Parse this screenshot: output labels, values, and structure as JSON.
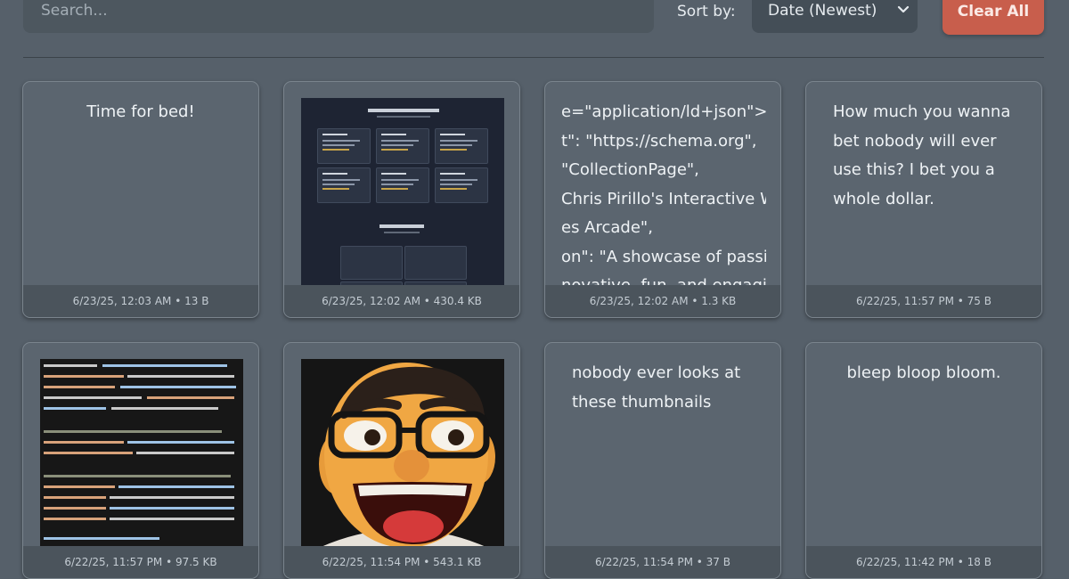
{
  "toolbar": {
    "search_placeholder": "Search...",
    "sort_label": "Sort by:",
    "sort_value": "Date (Newest)",
    "clear_label": "Clear All"
  },
  "colors": {
    "background": "#56606a",
    "card": "#5b656f",
    "accent_button": "#c85e4c"
  },
  "cards": [
    {
      "type": "text",
      "text": "Time for bed!",
      "meta": "6/23/25, 12:03 AM • 13 B"
    },
    {
      "type": "image",
      "image": "dark-webpage-screenshot",
      "meta": "6/23/25, 12:02 AM • 430.4 KB"
    },
    {
      "type": "code",
      "lines": [
        "e=\"application/ld+json\"> {",
        "t\": \"https://schema.org\",",
        "\"CollectionPage\",",
        "Chris Pirillo's Interactive W",
        "es Arcade\",",
        "on\": \"A showcase of passic",
        "novative, fun, and engagin"
      ],
      "meta": "6/23/25, 12:02 AM • 1.3 KB"
    },
    {
      "type": "text",
      "text": "How much you wanna bet nobody will ever use this? I bet you a whole dollar.",
      "meta": "6/22/25, 11:57 PM • 75 B"
    },
    {
      "type": "image",
      "image": "code-editor-screenshot",
      "meta": "6/22/25, 11:57 PM • 97.5 KB"
    },
    {
      "type": "image",
      "image": "cartoon-puppet-portrait",
      "meta": "6/22/25, 11:54 PM • 543.1 KB"
    },
    {
      "type": "text",
      "text": "nobody ever looks at these thumbnails",
      "meta": "6/22/25, 11:54 PM • 37 B"
    },
    {
      "type": "text",
      "text": "bleep bloop bloom.",
      "meta": "6/22/25, 11:42 PM • 18 B"
    }
  ]
}
